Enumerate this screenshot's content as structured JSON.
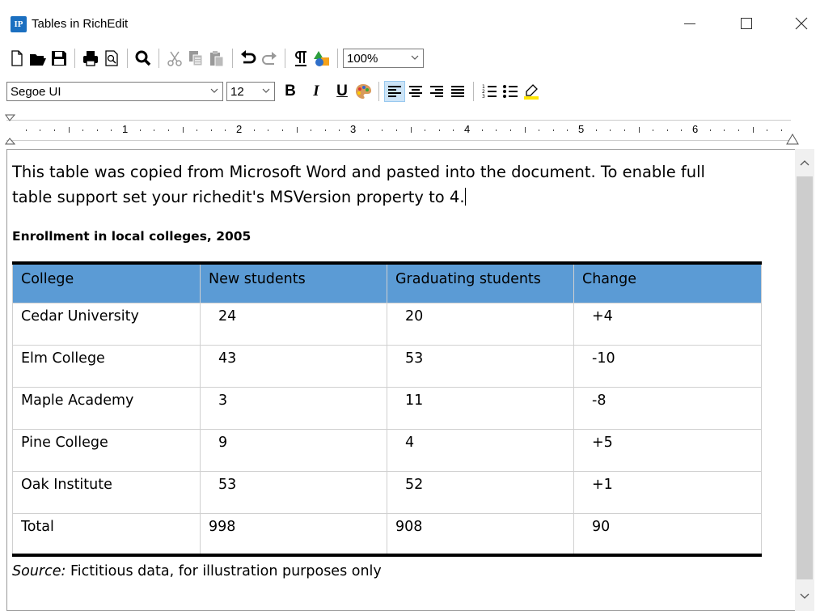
{
  "window": {
    "icon_text": "IP",
    "title": "Tables in RichEdit"
  },
  "toolbar1": {
    "zoom": "100%"
  },
  "toolbar2": {
    "font_name": "Segoe UI",
    "font_size": "12",
    "bold": "B",
    "italic": "I",
    "underline": "U"
  },
  "ruler": {
    "numbers": [
      "1",
      "2",
      "3",
      "4",
      "5",
      "6"
    ]
  },
  "document": {
    "paragraph_line1": "This table was copied from Microsoft Word and pasted into the document.  To enable full",
    "paragraph_line2": "table support set your richedit's MSVersion property to 4.",
    "heading": "Enrollment in local colleges, 2005",
    "table": {
      "headers": [
        "College",
        "New students",
        "Graduating students",
        "Change"
      ],
      "rows": [
        [
          "Cedar University",
          "24",
          "20",
          "+4"
        ],
        [
          "Elm College",
          "43",
          "53",
          "-10"
        ],
        [
          "Maple Academy",
          "3",
          "11",
          "-8"
        ],
        [
          "Pine College",
          "9",
          "4",
          "+5"
        ],
        [
          "Oak Institute",
          "53",
          "52",
          "+1"
        ],
        [
          "Total",
          "998",
          "908",
          "90"
        ]
      ]
    },
    "source_label": "Source:",
    "source_text": " Fictitious data, for illustration purposes only"
  },
  "colors": {
    "header_fill": "#5b9bd5",
    "app_icon": "#1b6fc0"
  }
}
